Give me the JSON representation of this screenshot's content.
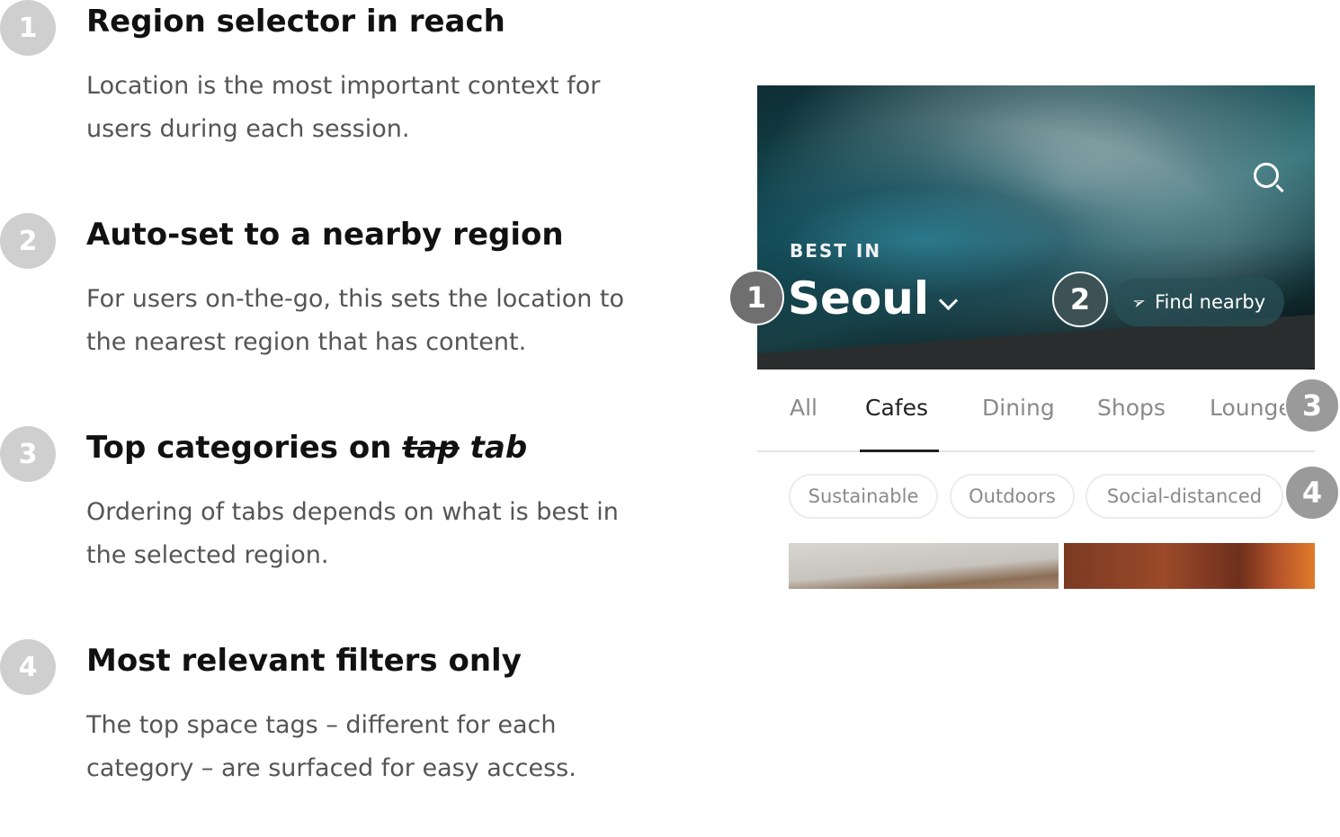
{
  "notes": [
    {
      "num": "1",
      "title": "Region selector in reach",
      "body": "Location is the most important context for users during each session."
    },
    {
      "num": "2",
      "title": "Auto-set to a nearby region",
      "body": "For users on-the-go, this sets the location to the nearest region that has content."
    },
    {
      "num": "3",
      "title_prefix": "Top categories on ",
      "title_strike": "tap",
      "title_suffix": " tab",
      "body": "Ordering of tabs depends on what is best in the selected region."
    },
    {
      "num": "4",
      "title": "Most relevant filters only",
      "body": "The top space tags – different for each category – are surfaced for easy access."
    }
  ],
  "hero": {
    "eyebrow": "BEST IN",
    "city": "Seoul",
    "find_nearby": "Find nearby"
  },
  "callouts": [
    "1",
    "2",
    "3",
    "4"
  ],
  "tabs": [
    "All",
    "Cafes",
    "Dining",
    "Shops",
    "Lounges"
  ],
  "active_tab": "Cafes",
  "chips": [
    "Sustainable",
    "Outdoors",
    "Social-distanced"
  ]
}
